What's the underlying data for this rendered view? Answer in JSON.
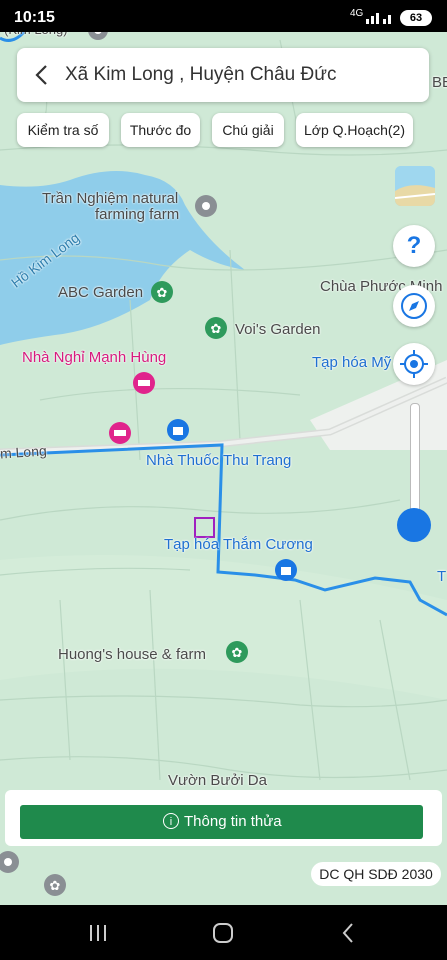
{
  "status_bar": {
    "time": "10:15",
    "network": "4G",
    "battery": "63"
  },
  "header": {
    "title": "Xã Kim Long , Huyện Châu Đức"
  },
  "chips": [
    {
      "label": "Kiểm tra số"
    },
    {
      "label": "Thước đo"
    },
    {
      "label": "Chú giải"
    },
    {
      "label": "Lớp Q.Hoạch(2)"
    }
  ],
  "map": {
    "labels": {
      "kim_long_top": "(Kim Long)",
      "tran_nghiem_1": "Trần Nghiệm natural",
      "tran_nghiem_2": "farming farm",
      "ho_kim_long": "Hồ Kim Long",
      "abc_garden": "ABC Garden",
      "chua_phuoc_minh": "Chùa Phước Minh",
      "vois_garden": "Voi's Garden",
      "nha_nghi": "Nhà Nghỉ Mạnh Hùng",
      "tap_hoa_my": "Tạp hóa Mỹ",
      "road_kim_long": "m Long",
      "nha_thuoc": "Nhà Thuốc Thu Trang",
      "tap_hoa_tham_cuong": "Tạp hóa Thắm Cương",
      "huongs_house": "Huong's house & farm",
      "vuon_buoi": "Vườn Bưởi Da",
      "edge_be": "BE",
      "edge_t": "T"
    },
    "colors": {
      "road_route": "#2a8fe8",
      "water": "#8fcdea",
      "land": "#cfe9d6",
      "accent": "#1f8a4c",
      "pink": "#e0248c"
    }
  },
  "controls": {
    "help": "?"
  },
  "bottom": {
    "info_button": "Thông tin thửa",
    "plan_label": "DC QH SDĐ 2030"
  }
}
